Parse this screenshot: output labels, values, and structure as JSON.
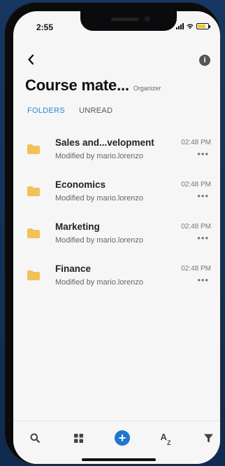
{
  "status_bar": {
    "time": "2:55"
  },
  "header": {
    "title": "Course mate...",
    "subtitle": "Organizer"
  },
  "tabs": [
    {
      "label": "FOLDERS",
      "active": true
    },
    {
      "label": "UNREAD",
      "active": false
    }
  ],
  "folders": [
    {
      "name": "Sales and...velopment",
      "modified": "Modified by mario.lorenzo",
      "time": "02:48 PM"
    },
    {
      "name": "Economics",
      "modified": "Modified by mario.lorenzo",
      "time": "02:48 PM"
    },
    {
      "name": "Marketing",
      "modified": "Modified by mario.lorenzo",
      "time": "02:48 PM"
    },
    {
      "name": "Finance",
      "modified": "Modified by mario.lorenzo",
      "time": "02:48 PM"
    }
  ],
  "more_label": "•••",
  "toolbar": {
    "sort_label": "A",
    "sort_sub": "Z"
  },
  "colors": {
    "accent": "#2a88d4",
    "folder": "#f3c158",
    "fab": "#1f77cf",
    "background": "#153762"
  },
  "icons": {
    "back": "chevron-left-icon",
    "info": "info-icon",
    "folder": "folder-icon",
    "search": "search-icon",
    "grid": "grid-icon",
    "add": "plus-circle-icon",
    "sort": "sort-az-icon",
    "filter": "filter-icon"
  }
}
